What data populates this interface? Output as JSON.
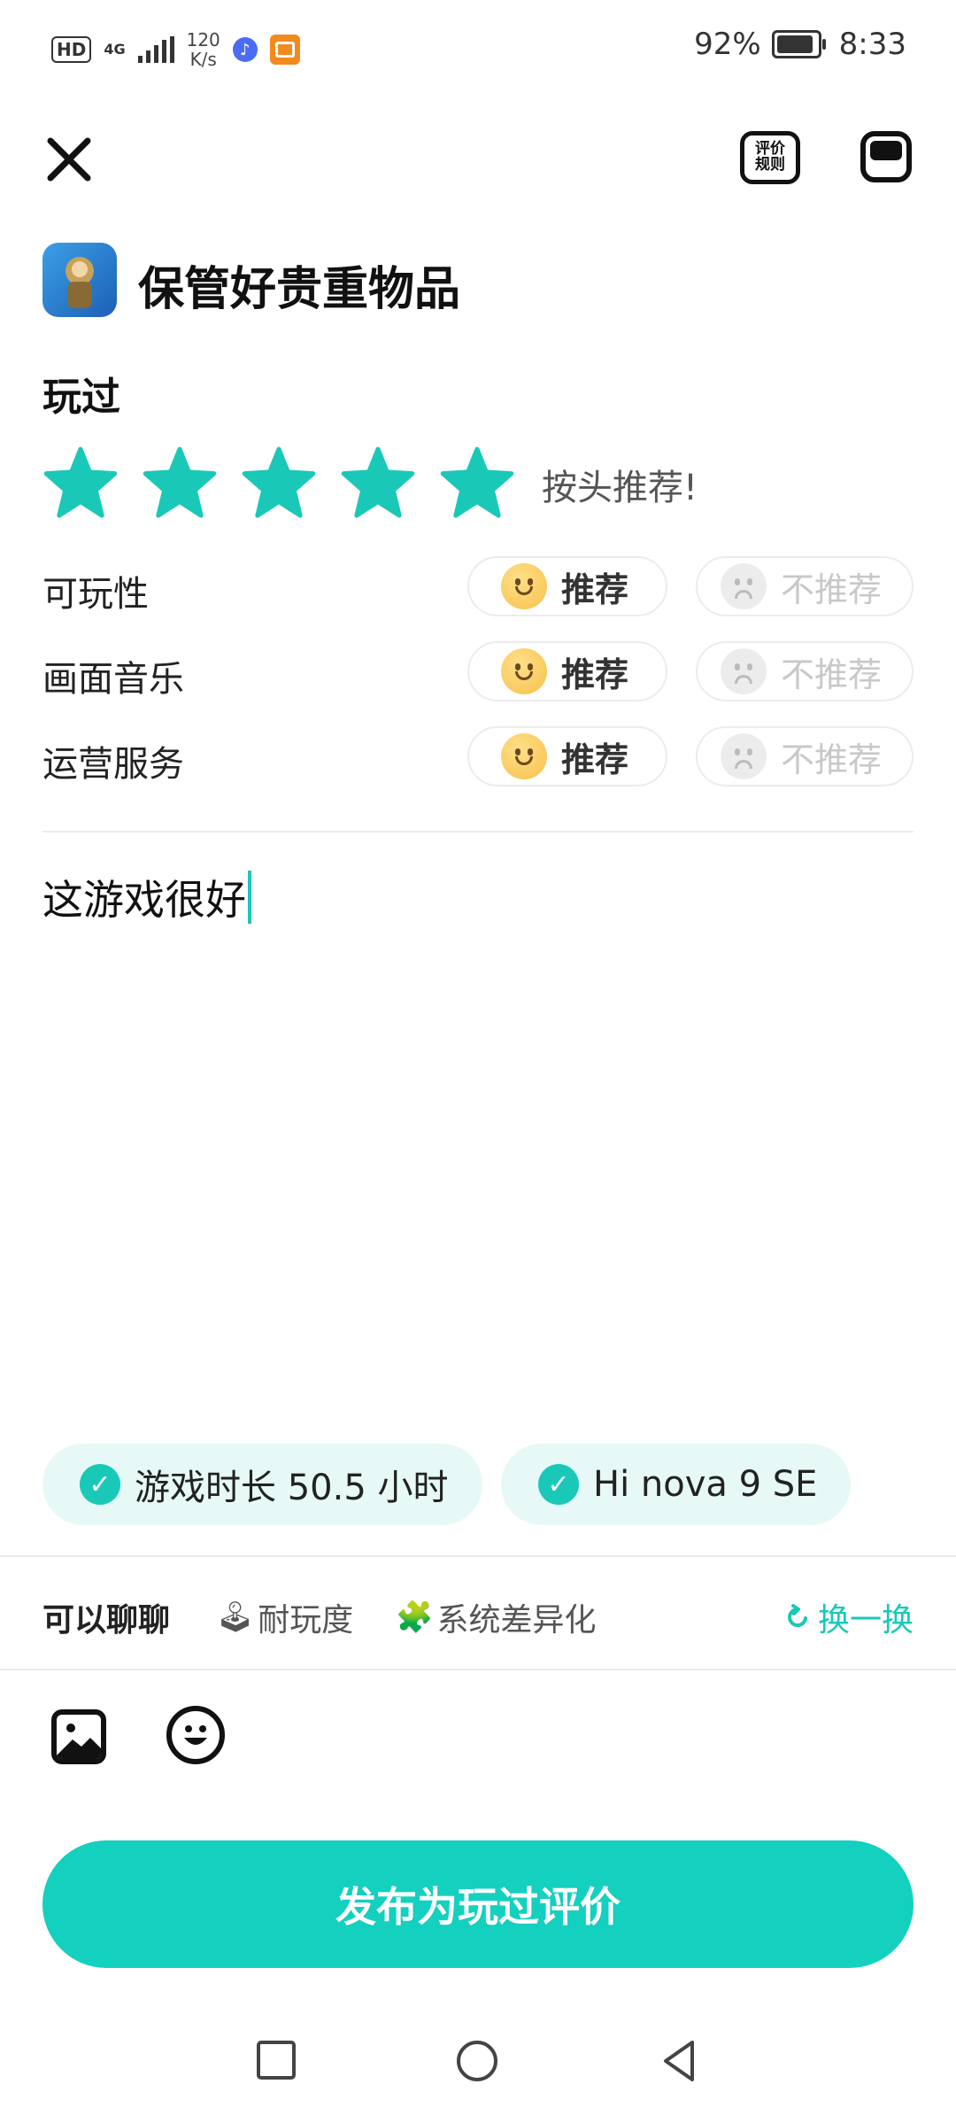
{
  "status_bar": {
    "hd": "HD",
    "network": "4G",
    "speed_value": "120",
    "speed_unit": "K/s",
    "battery": "92%",
    "time": "8:33"
  },
  "header": {
    "close_icon": "close-icon",
    "rules_line1": "评价",
    "rules_line2": "规则",
    "feedback_icon": "chat-icon"
  },
  "game": {
    "title": "保管好贵重物品"
  },
  "rating": {
    "section_label": "玩过",
    "stars": 5,
    "max_stars": 5,
    "caption": "按头推荐!",
    "accent": "#1ac8b8"
  },
  "aspects": [
    {
      "label": "可玩性",
      "recommend": "推荐",
      "not_recommend": "不推荐"
    },
    {
      "label": "画面音乐",
      "recommend": "推荐",
      "not_recommend": "不推荐"
    },
    {
      "label": "运营服务",
      "recommend": "推荐",
      "not_recommend": "不推荐"
    }
  ],
  "comment": {
    "text": "这游戏很好"
  },
  "tags": [
    {
      "text": "游戏时长 50.5 小时"
    },
    {
      "text": "Hi nova 9 SE"
    }
  ],
  "chat": {
    "title": "可以聊聊",
    "topics": [
      {
        "emoji": "🕹",
        "text": "耐玩度"
      },
      {
        "emoji": "🧩",
        "text": "系统差异化"
      }
    ],
    "refresh_label": "换一换"
  },
  "toolbar": {
    "image_icon": "image-icon",
    "emoji_icon": "emoji-icon"
  },
  "publish_label": "发布为玩过评价"
}
